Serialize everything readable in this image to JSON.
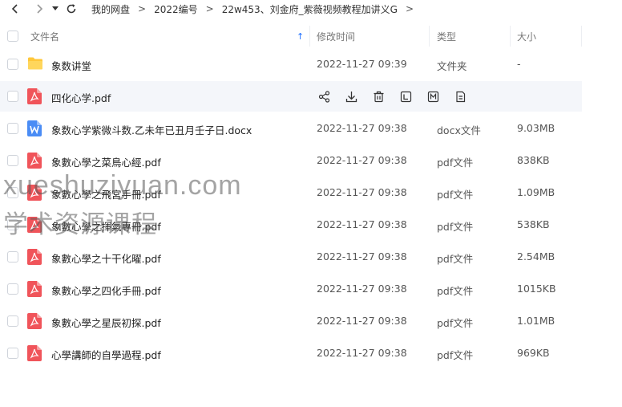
{
  "breadcrumb": {
    "segments": [
      "我的网盘",
      "2022编号",
      "22w453、刘金府_紫薇视频教程加讲义G"
    ],
    "separator": ">"
  },
  "columns": {
    "name": "文件名",
    "date": "修改时间",
    "type": "类型",
    "size": "大小"
  },
  "files": [
    {
      "name": "象数讲堂",
      "date": "2022-11-27 09:39",
      "type": "文件夹",
      "size": "-",
      "icon": "folder-icon"
    },
    {
      "name": "四化心学.pdf",
      "date": "",
      "type": "",
      "size": "",
      "icon": "pdf-icon"
    },
    {
      "name": "象数心学紫微斗数.乙未年已丑月壬子日.docx",
      "date": "2022-11-27 09:38",
      "type": "docx文件",
      "size": "9.03MB",
      "icon": "word-icon"
    },
    {
      "name": "象數心學之菜鳥心經.pdf",
      "date": "2022-11-27 09:38",
      "type": "pdf文件",
      "size": "838KB",
      "icon": "pdf-icon"
    },
    {
      "name": "象數心學之飛宮手冊.pdf",
      "date": "2022-11-27 09:38",
      "type": "pdf文件",
      "size": "1.09MB",
      "icon": "pdf-icon"
    },
    {
      "name": "象數心學之揮氣專冊.pdf",
      "date": "2022-11-27 09:38",
      "type": "pdf文件",
      "size": "538KB",
      "icon": "pdf-icon"
    },
    {
      "name": "象數心學之十干化曜.pdf",
      "date": "2022-11-27 09:38",
      "type": "pdf文件",
      "size": "2.54MB",
      "icon": "pdf-icon"
    },
    {
      "name": "象數心學之四化手冊.pdf",
      "date": "2022-11-27 09:38",
      "type": "pdf文件",
      "size": "1015KB",
      "icon": "pdf-icon"
    },
    {
      "name": "象數心學之星辰初探.pdf",
      "date": "2022-11-27 09:38",
      "type": "pdf文件",
      "size": "1.01MB",
      "icon": "pdf-icon"
    },
    {
      "name": "心學講師的自學過程.pdf",
      "date": "2022-11-27 09:38",
      "type": "pdf文件",
      "size": "969KB",
      "icon": "pdf-icon"
    }
  ],
  "hover_actions": [
    "share-icon",
    "download-icon",
    "delete-icon",
    "rename-icon",
    "move-icon",
    "more-icon"
  ],
  "watermark": {
    "line1": "xueshuziyuan.com",
    "line2": "学术资源课程"
  },
  "colors": {
    "accent": "#1e6fff",
    "pdf": "#f0545a",
    "folder": "#ffc73a",
    "word": "#4a8cf5"
  }
}
